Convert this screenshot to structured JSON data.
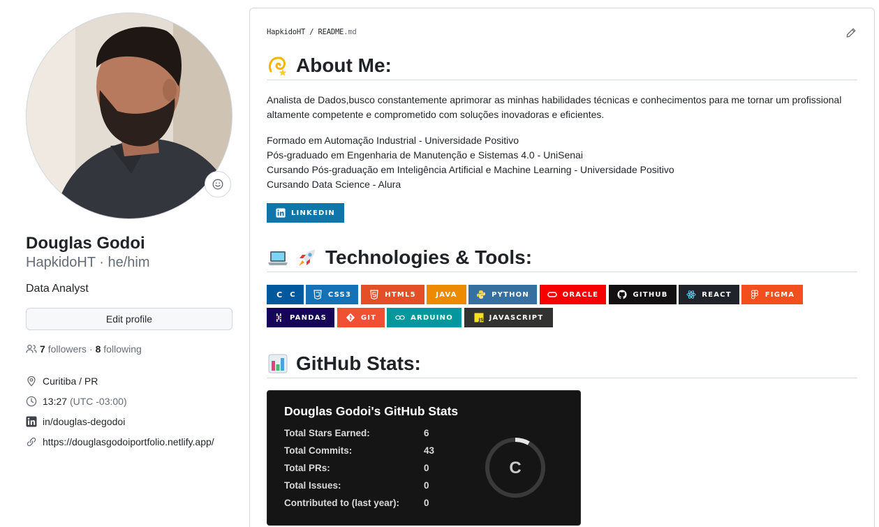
{
  "profile": {
    "name": "Douglas Godoi",
    "username": "HapkidoHT",
    "pronouns": "he/him",
    "username_line": "HapkidoHT · he/him",
    "bio": "Data Analyst",
    "edit_button": "Edit profile",
    "followers_count": "7",
    "followers_label": "followers",
    "following_count": "8",
    "following_label": "following",
    "separator": "·",
    "location": "Curitiba / PR",
    "time": "13:27",
    "timezone": "(UTC -03:00)",
    "linkedin": "in/douglas-degodoi",
    "website": "https://douglasgodoiportfolio.netlify.app/"
  },
  "readme": {
    "path_user": "HapkidoHT",
    "path_sep": " / ",
    "path_file": "README",
    "path_ext": ".md",
    "about_heading": "About Me:",
    "about_text": "Analista de Dados,busco constantemente aprimorar as minhas habilidades técnicas e conhecimentos para me tornar um profissional altamente competente e comprometido com soluções inovadoras e eficientes.",
    "education": [
      "Formado em Automação Industrial - Universidade Positivo",
      "Pós-graduado em Engenharia de Manutenção e Sistemas 4.0 - UniSenai",
      "Cursando Pós-graduação em Inteligência Artificial e Machine Learning - Universidade Positivo",
      "Cursando Data Science - Alura"
    ],
    "linkedin_badge": "LINKEDIN",
    "tech_heading": "Technologies & Tools:",
    "badges": [
      {
        "label": "C",
        "color": "#00599C",
        "icon": "c-icon"
      },
      {
        "label": "CSS3",
        "color": "#1572B6",
        "icon": "css3-icon"
      },
      {
        "label": "HTML5",
        "color": "#E34F26",
        "icon": "html5-icon"
      },
      {
        "label": "JAVA",
        "color": "#ED8B00",
        "icon": "none"
      },
      {
        "label": "PYTHON",
        "color": "#3670A0",
        "icon": "python-icon"
      },
      {
        "label": "ORACLE",
        "color": "#F80000",
        "icon": "oracle-icon"
      },
      {
        "label": "GITHUB",
        "color": "#121011",
        "icon": "github-icon"
      },
      {
        "label": "REACT",
        "color": "#20232A",
        "icon": "react-icon"
      },
      {
        "label": "FIGMA",
        "color": "#F24E1E",
        "icon": "figma-icon"
      },
      {
        "label": "PANDAS",
        "color": "#150458",
        "icon": "pandas-icon"
      },
      {
        "label": "GIT",
        "color": "#F05033",
        "icon": "git-icon"
      },
      {
        "label": "ARDUINO",
        "color": "#00979D",
        "icon": "arduino-icon"
      },
      {
        "label": "JAVASCRIPT",
        "color": "#323330",
        "icon": "javascript-icon"
      }
    ],
    "stats_heading": "GitHub Stats:"
  },
  "stats_card": {
    "title": "Douglas Godoi's GitHub Stats",
    "rows": [
      {
        "label": "Total Stars Earned:",
        "value": "6"
      },
      {
        "label": "Total Commits:",
        "value": "43"
      },
      {
        "label": "Total PRs:",
        "value": "0"
      },
      {
        "label": "Total Issues:",
        "value": "0"
      },
      {
        "label": "Contributed to (last year):",
        "value": "0"
      }
    ],
    "rank": "C",
    "rank_progress": 0.08
  },
  "colors": {
    "linkedin": "#0A66C2",
    "link_muted": "#656d76",
    "text": "#1f2328"
  }
}
